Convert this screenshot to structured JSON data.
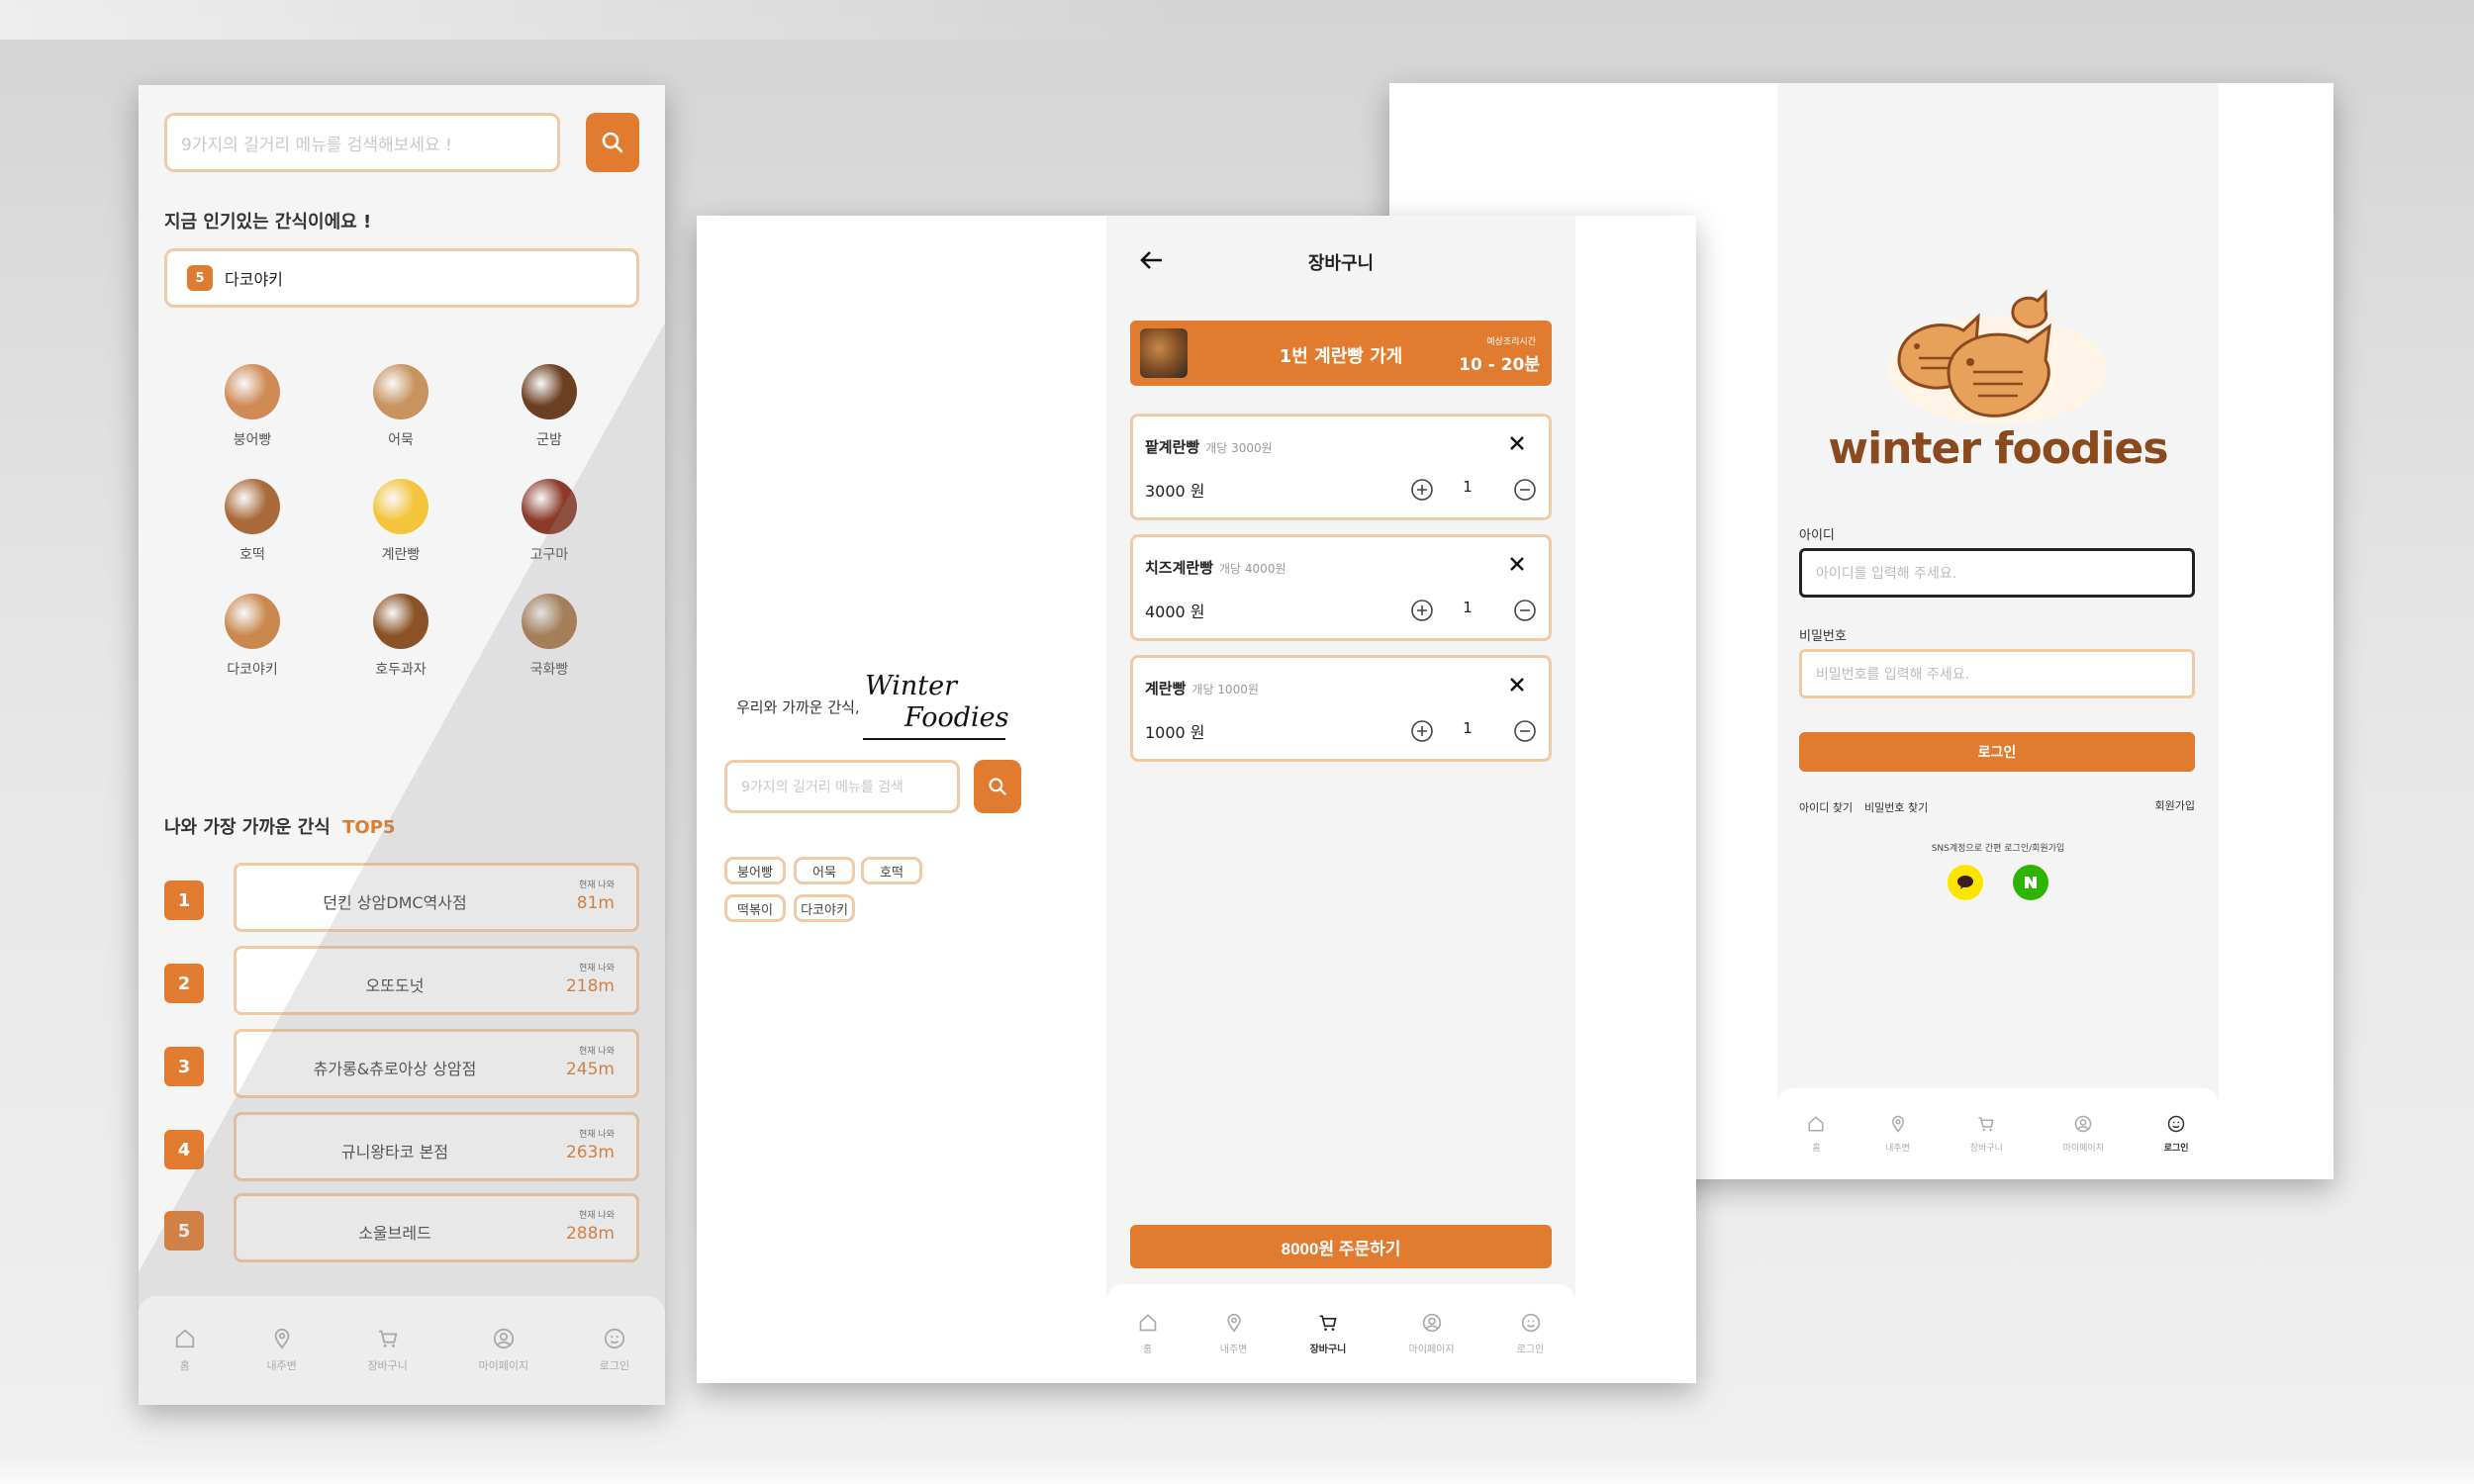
{
  "home": {
    "search_placeholder": "9가지의 길거리 메뉴를 검색해보세요 !",
    "popular_title": "지금 인기있는 간식이에요 !",
    "popular_rank": "5",
    "popular_item": "다코야키",
    "foods": [
      {
        "label": "붕어빵",
        "color": "#d08a56"
      },
      {
        "label": "어묵",
        "color": "#c8935f"
      },
      {
        "label": "군밤",
        "color": "#6b3f22"
      },
      {
        "label": "호떡",
        "color": "#a96a3a"
      },
      {
        "label": "계란빵",
        "color": "#f4c43a"
      },
      {
        "label": "고구마",
        "color": "#8c3b2a"
      },
      {
        "label": "다코야키",
        "color": "#c9894e"
      },
      {
        "label": "호두과자",
        "color": "#8a5226"
      },
      {
        "label": "국화빵",
        "color": "#a8794a"
      }
    ],
    "top5_title_prefix": "나와 가장 가까운 간식",
    "top5_title_suffix": "TOP5",
    "distance_label": "현재 나와",
    "top5": [
      {
        "rank": "1",
        "name": "던킨 상암DMC역사점",
        "dist": "81m"
      },
      {
        "rank": "2",
        "name": "오또도넛",
        "dist": "218m"
      },
      {
        "rank": "3",
        "name": "츄가롱&츄로아상 상암점",
        "dist": "245m"
      },
      {
        "rank": "4",
        "name": "규니왕타코 본점",
        "dist": "263m"
      },
      {
        "rank": "5",
        "name": "소울브레드",
        "dist": "288m"
      }
    ]
  },
  "nav": {
    "home": "홈",
    "location": "내주변",
    "cart": "장바구니",
    "mypage": "마이페이지",
    "login": "로그인"
  },
  "landing": {
    "tagline": "우리와 가까운 간식,",
    "brand_line1": "Winter",
    "brand_line2": "Foodies",
    "search_placeholder": "9가지의 길거리 메뉴를 검색",
    "chips": [
      "붕어빵",
      "어묵",
      "호떡",
      "떡볶이",
      "다코야키"
    ]
  },
  "cart": {
    "title": "장바구니",
    "store_name": "1번 계란빵 가게",
    "wait_label": "예상조리시간",
    "wait_time": "10 - 20분",
    "items": [
      {
        "name": "팥계란빵",
        "unit": "개당 3000원",
        "price": "3000 원",
        "qty": "1"
      },
      {
        "name": "치즈계란빵",
        "unit": "개당 4000원",
        "price": "4000 원",
        "qty": "1"
      },
      {
        "name": "계란빵",
        "unit": "개당 1000원",
        "price": "1000 원",
        "qty": "1"
      }
    ],
    "order_button": "8000원 주문하기"
  },
  "login": {
    "logo_text": "winter foodies",
    "id_label": "아이디",
    "id_placeholder": "아이디를 입력해 주세요.",
    "pw_label": "비밀번호",
    "pw_placeholder": "비밀번호를 입력해 주세요.",
    "login_button": "로그인",
    "find_id": "아이디 찾기",
    "find_pw": "비밀번호 찾기",
    "signup": "회원가입",
    "sns_label": "SNS계정으로 간편 로그인/회원가입"
  },
  "colors": {
    "accent": "#e07b2f",
    "accent_border": "#f1c9a4",
    "kakao": "#fee500",
    "naver": "#2db400"
  }
}
